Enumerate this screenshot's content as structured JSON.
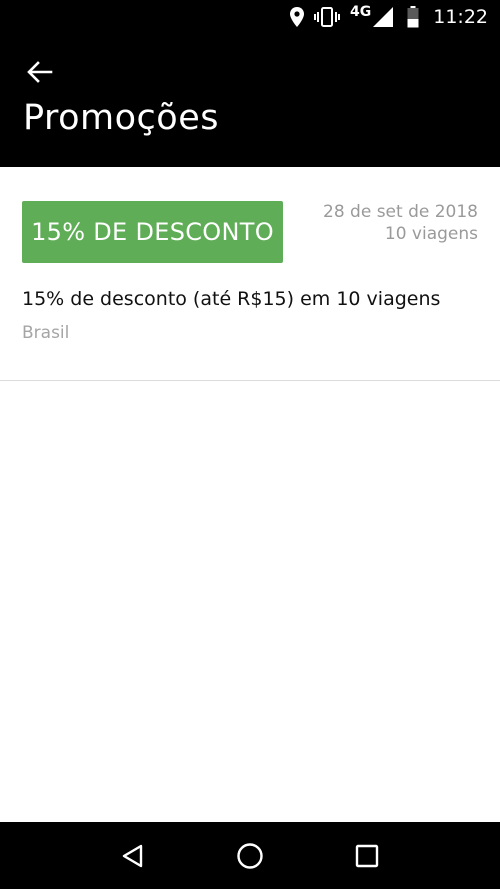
{
  "status_bar": {
    "network_label": "4G",
    "time": "11:22",
    "icons": [
      "location-icon",
      "vibrate-icon",
      "signal-icon",
      "battery-icon"
    ]
  },
  "header": {
    "title": "Promoções",
    "back_icon": "arrow-back-icon"
  },
  "promo": {
    "badge_label": "15% DE DESCONTO",
    "date": "28 de set de 2018",
    "trips": "10 viagens",
    "description": "15% de desconto (até R$15) em 10 viagens",
    "region": "Brasil",
    "badge_color": "#5fad56"
  },
  "nav_bar": {
    "icons": [
      "back-triangle-icon",
      "home-circle-icon",
      "recents-square-icon"
    ]
  }
}
